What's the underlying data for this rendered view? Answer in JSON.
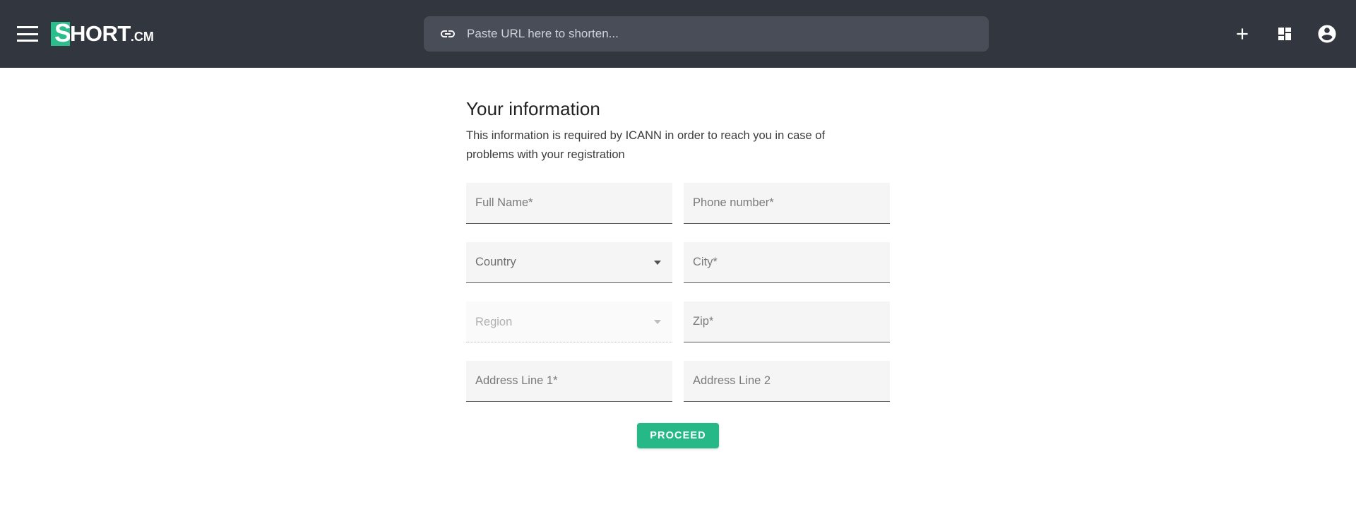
{
  "header": {
    "menu_icon": "hamburger-menu-icon",
    "brand": {
      "mark_letter": "S",
      "name": "HORT",
      "tld": ".CM",
      "mark_color": "#2bbd8c"
    },
    "url_input": {
      "icon": "link-icon",
      "value": "",
      "placeholder": "Paste URL here to shorten..."
    },
    "actions": [
      {
        "name": "add-new-button",
        "icon": "plus-icon"
      },
      {
        "name": "dashboard-button",
        "icon": "dashboard-grid-icon"
      },
      {
        "name": "account-button",
        "icon": "account-circle-icon"
      }
    ],
    "background_color": "#32363f",
    "input_background_color": "#494d57"
  },
  "form": {
    "title": "Your information",
    "subtitle": "This information is required by ICANN in order to reach you in case of problems with your registration",
    "fields": {
      "full_name": {
        "label": "Full Name*",
        "value": "",
        "placeholder": "Full Name*"
      },
      "phone": {
        "label": "Phone number*",
        "value": "",
        "placeholder": "Phone number*"
      },
      "country": {
        "label": "Country",
        "selected": "Country",
        "enabled": true
      },
      "city": {
        "label": "City*",
        "value": "",
        "placeholder": "City*"
      },
      "region": {
        "label": "Region",
        "selected": "Region",
        "enabled": false
      },
      "zip": {
        "label": "Zip*",
        "value": "",
        "placeholder": "Zip*"
      },
      "address1": {
        "label": "Address Line 1*",
        "value": "",
        "placeholder": "Address Line 1*"
      },
      "address2": {
        "label": "Address Line 2",
        "value": "",
        "placeholder": "Address Line 2"
      }
    },
    "submit_label": "PROCEED",
    "accent_color": "#26b887"
  }
}
